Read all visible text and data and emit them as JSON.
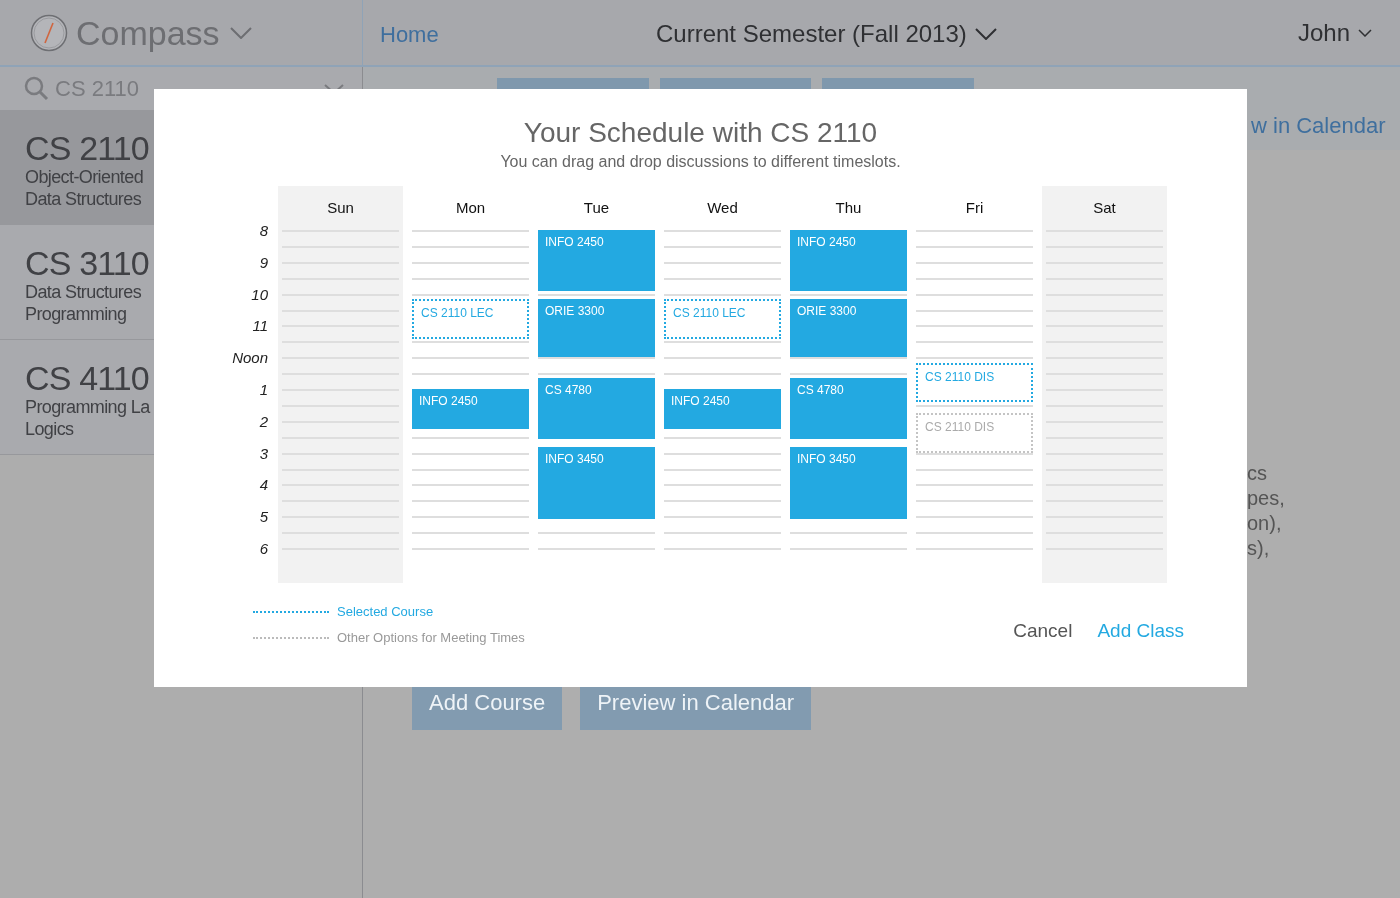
{
  "app": {
    "logo": "Compass",
    "nav_home": "Home",
    "semester": "Current Semester (Fall 2013)",
    "user": "John"
  },
  "search": {
    "value": "CS 2110"
  },
  "sidebar": {
    "items": [
      {
        "code": "CS 2110",
        "title": "Object-Oriented\nData Structures",
        "selected": true
      },
      {
        "code": "CS 3110",
        "title": "Data Structures\nProgramming",
        "selected": false
      },
      {
        "code": "CS 4110",
        "title": "Programming La\nLogics",
        "selected": false
      }
    ]
  },
  "background_content": {
    "calendar_link": "w in Calendar",
    "text_fragments": [
      "cs",
      "pes,",
      "on),",
      "s),"
    ],
    "buttons": [
      "Add Course",
      "Preview in Calendar"
    ]
  },
  "dialog": {
    "title": "Your Schedule with CS 2110",
    "subtitle": "You can drag and drop discussions to different timeslots.",
    "hours": [
      "8",
      "9",
      "10",
      "11",
      "Noon",
      "1",
      "2",
      "3",
      "4",
      "5",
      "6"
    ],
    "days": [
      {
        "label": "Sun",
        "weekend": true
      },
      {
        "label": "Mon",
        "weekend": false,
        "events": [
          {
            "label": "CS 2110 LEC",
            "kind": "selected"
          },
          {
            "label": "INFO 2450",
            "kind": "class"
          }
        ]
      },
      {
        "label": "Tue",
        "weekend": false,
        "events": [
          {
            "label": "INFO 2450",
            "kind": "class"
          },
          {
            "label": "ORIE 3300",
            "kind": "class"
          },
          {
            "label": "CS 4780",
            "kind": "class"
          },
          {
            "label": "INFO 3450",
            "kind": "class"
          }
        ]
      },
      {
        "label": "Wed",
        "weekend": false,
        "events": [
          {
            "label": "CS 2110 LEC",
            "kind": "selected"
          },
          {
            "label": "INFO 2450",
            "kind": "class"
          }
        ]
      },
      {
        "label": "Thu",
        "weekend": false,
        "events": [
          {
            "label": "INFO 2450",
            "kind": "class"
          },
          {
            "label": "ORIE 3300",
            "kind": "class"
          },
          {
            "label": "CS 4780",
            "kind": "class"
          },
          {
            "label": "INFO 3450",
            "kind": "class"
          }
        ]
      },
      {
        "label": "Fri",
        "weekend": false,
        "events": [
          {
            "label": "CS 2110 DIS",
            "kind": "selected"
          },
          {
            "label": "CS 2110 DIS",
            "kind": "option"
          }
        ]
      },
      {
        "label": "Sat",
        "weekend": true
      }
    ],
    "legend": [
      {
        "kind": "selected",
        "label": "Selected Course"
      },
      {
        "kind": "option",
        "label": "Other Options for Meeting Times"
      }
    ],
    "buttons": [
      {
        "label": "Cancel",
        "kind": "secondary"
      },
      {
        "label": "Add Class",
        "kind": "primary"
      }
    ]
  }
}
